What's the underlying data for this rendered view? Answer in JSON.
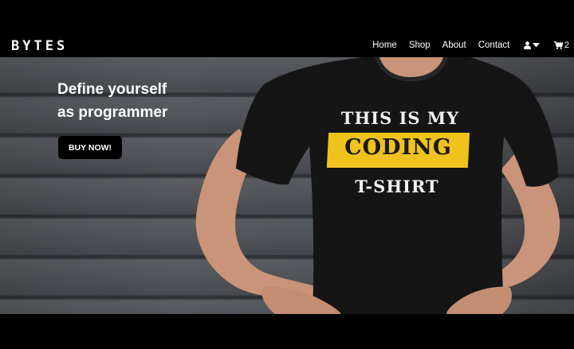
{
  "brand": {
    "name": "BYTES"
  },
  "nav": {
    "links": [
      {
        "label": "Home"
      },
      {
        "label": "Shop"
      },
      {
        "label": "About"
      },
      {
        "label": "Contact"
      }
    ],
    "user_icon": "user-icon",
    "caret_icon": "caret-down-icon",
    "cart_icon": "cart-icon",
    "cart_count": "2"
  },
  "hero": {
    "headline_line1": "Define yourself",
    "headline_line2": "as programmer",
    "cta_label": "BUY NOW!",
    "shirt_text": {
      "line1": "THIS IS MY",
      "line2": "CODING",
      "line3": "T-SHIRT"
    }
  },
  "colors": {
    "background": "#000000",
    "text": "#ffffff",
    "wall": "#4b4e52",
    "shirt": "#111111",
    "highlight": "#f0c21c"
  }
}
